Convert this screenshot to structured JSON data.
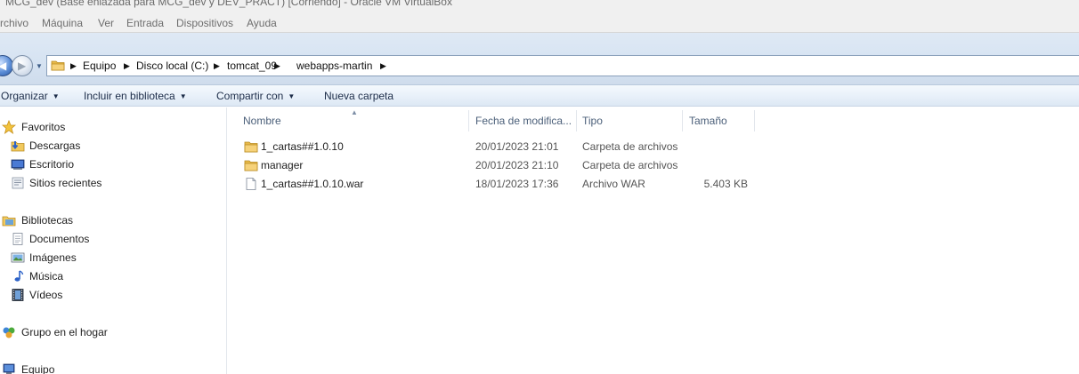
{
  "vm": {
    "title": "MCG_dev (Base enlazada para MCG_dev y DEV_PRACT) [Corriendo] - Oracle VM VirtualBox",
    "menu": [
      "rchivo",
      "Máquina",
      "Ver",
      "Entrada",
      "Dispositivos",
      "Ayuda"
    ]
  },
  "address": {
    "breadcrumbs": [
      "Equipo",
      "Disco local (C:)",
      "tomcat_09",
      "webapps-martin"
    ]
  },
  "toolbar": {
    "organize": "Organizar",
    "include_library": "Incluir en biblioteca",
    "share": "Compartir con",
    "new_folder": "Nueva carpeta"
  },
  "nav": {
    "favorites": "Favoritos",
    "downloads": "Descargas",
    "desktop": "Escritorio",
    "recent": "Sitios recientes",
    "libraries": "Bibliotecas",
    "documents": "Documentos",
    "pictures": "Imágenes",
    "music": "Música",
    "videos": "Vídeos",
    "homegroup": "Grupo en el hogar",
    "computer": "Equipo"
  },
  "columns": {
    "name": "Nombre",
    "date": "Fecha de modifica...",
    "type": "Tipo",
    "size": "Tamaño"
  },
  "files": [
    {
      "name": "1_cartas##1.0.10",
      "date": "20/01/2023 21:01",
      "type": "Carpeta de archivos",
      "size": "",
      "icon": "folder-icon"
    },
    {
      "name": "manager",
      "date": "20/01/2023 21:10",
      "type": "Carpeta de archivos",
      "size": "",
      "icon": "folder-icon"
    },
    {
      "name": "1_cartas##1.0.10.war",
      "date": "18/01/2023 17:36",
      "type": "Archivo WAR",
      "size": "5.403 KB",
      "icon": "file-icon"
    }
  ]
}
